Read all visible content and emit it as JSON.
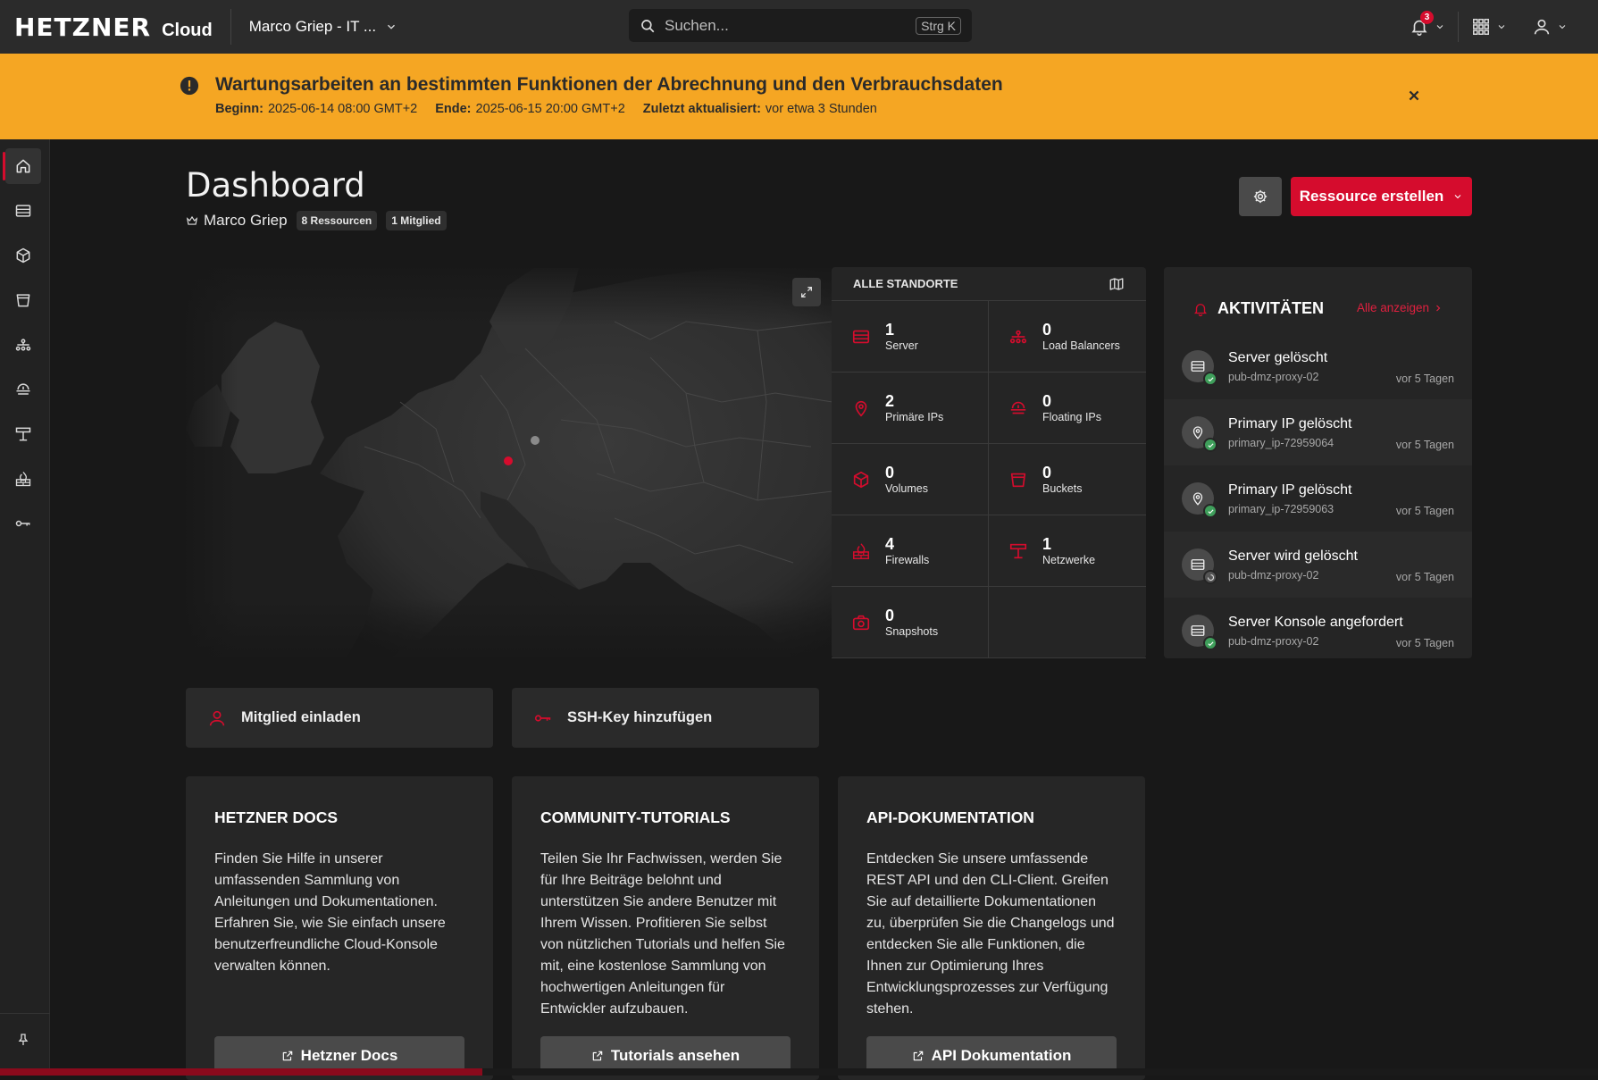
{
  "brand": {
    "logo": "HETZNER",
    "product": "Cloud"
  },
  "project": {
    "name": "Marco Griep - IT ..."
  },
  "search": {
    "placeholder": "Suchen...",
    "shortcut": "Strg K"
  },
  "notifications": {
    "count": "3"
  },
  "banner": {
    "title": "Wartungsarbeiten an bestimmten Funktionen der Abrechnung und den Verbrauchsdaten",
    "start_label": "Beginn:",
    "start_value": "2025-06-14 08:00 GMT+2",
    "end_label": "Ende:",
    "end_value": "2025-06-15 20:00 GMT+2",
    "updated_label": "Zuletzt aktualisiert:",
    "updated_value": "vor etwa 3 Stunden"
  },
  "page": {
    "title": "Dashboard",
    "owner": "Marco Griep",
    "resources_chip": "8 Ressourcen",
    "members_chip": "1 Mitglied",
    "create_button": "Ressource erstellen"
  },
  "sidebar": {
    "items": [
      {
        "icon": "home-icon",
        "active": true
      },
      {
        "icon": "server-icon"
      },
      {
        "icon": "volume-icon"
      },
      {
        "icon": "bucket-icon"
      },
      {
        "icon": "load-balancer-icon"
      },
      {
        "icon": "floating-ip-icon"
      },
      {
        "icon": "network-icon"
      },
      {
        "icon": "firewall-icon"
      },
      {
        "icon": "key-icon"
      },
      {
        "icon": "pin-icon"
      }
    ]
  },
  "stats": {
    "header": "ALLE STANDORTE",
    "items": [
      {
        "count": "1",
        "label": "Server",
        "icon": "server-icon"
      },
      {
        "count": "0",
        "label": "Load Balancers",
        "icon": "load-balancer-icon"
      },
      {
        "count": "2",
        "label": "Primäre IPs",
        "icon": "primary-ip-icon"
      },
      {
        "count": "0",
        "label": "Floating IPs",
        "icon": "floating-ip-icon"
      },
      {
        "count": "0",
        "label": "Volumes",
        "icon": "volume-icon"
      },
      {
        "count": "0",
        "label": "Buckets",
        "icon": "bucket-icon"
      },
      {
        "count": "4",
        "label": "Firewalls",
        "icon": "firewall-icon"
      },
      {
        "count": "1",
        "label": "Netzwerke",
        "icon": "network-icon"
      },
      {
        "count": "0",
        "label": "Snapshots",
        "icon": "snapshot-icon"
      }
    ]
  },
  "activities": {
    "title": "AKTIVITÄTEN",
    "show_all": "Alle anzeigen",
    "items": [
      {
        "title": "Server gelöscht",
        "resource": "pub-dmz-proxy-02",
        "time": "vor 5 Tagen",
        "icon": "server-icon",
        "status": "success"
      },
      {
        "title": "Primary IP gelöscht",
        "resource": "primary_ip-72959064",
        "time": "vor 5 Tagen",
        "icon": "primary-ip-icon",
        "status": "success"
      },
      {
        "title": "Primary IP gelöscht",
        "resource": "primary_ip-72959063",
        "time": "vor 5 Tagen",
        "icon": "primary-ip-icon",
        "status": "success"
      },
      {
        "title": "Server wird gelöscht",
        "resource": "pub-dmz-proxy-02",
        "time": "vor 5 Tagen",
        "icon": "server-icon",
        "status": "pending"
      },
      {
        "title": "Server Konsole angefordert",
        "resource": "pub-dmz-proxy-02",
        "time": "vor 5 Tagen",
        "icon": "server-icon",
        "status": "success"
      }
    ]
  },
  "quick_actions": {
    "invite_member": "Mitglied einladen",
    "add_ssh_key": "SSH-Key hinzufügen"
  },
  "cards": [
    {
      "title": "HETZNER DOCS",
      "text": "Finden Sie Hilfe in unserer umfassenden Sammlung von Anleitungen und Dokumentationen. Erfahren Sie, wie Sie einfach unsere benutzerfreundliche Cloud-Konsole verwalten können.",
      "button": "Hetzner Docs"
    },
    {
      "title": "COMMUNITY-TUTORIALS",
      "text": "Teilen Sie Ihr Fachwissen, werden Sie für Ihre Beiträge belohnt und unterstützen Sie andere Benutzer mit Ihrem Wissen. Profitieren Sie selbst von nützlichen Tutorials und helfen Sie mit, eine kostenlose Sammlung von hochwertigen Anleitungen für Entwickler aufzubauen.",
      "button": "Tutorials ansehen"
    },
    {
      "title": "API-DOKUMENTATION",
      "text": "Entdecken Sie unsere umfassende REST API und den CLI-Client. Greifen Sie auf detaillierte Dokumentationen zu, überprüfen Sie die Changelogs und entdecken Sie alle Funktionen, die Ihnen zur Optimierung Ihres Entwicklungsprozesses zur Verfügung stehen.",
      "button": "API Dokumentation"
    }
  ],
  "colors": {
    "accent": "#d50c2d",
    "banner": "#f5a623",
    "success": "#3f9f5b"
  }
}
